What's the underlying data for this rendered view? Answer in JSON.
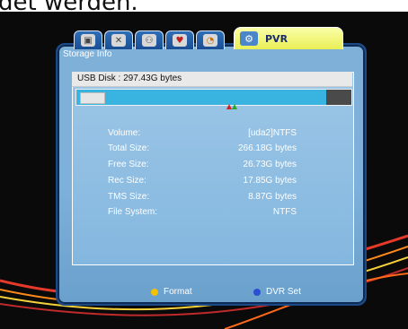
{
  "caption": "det werden.",
  "tabs": {
    "icons": [
      "film-reel-icon",
      "tools-icon",
      "network-icon",
      "heart-icon",
      "clock-icon"
    ],
    "active": {
      "icon": "gear-icon",
      "label": "PVR"
    }
  },
  "panel": {
    "title": "Storage Info",
    "disk_label": "USB Disk : 297.43G bytes",
    "usage_fraction": 0.91,
    "rows": [
      {
        "key": "Volume:",
        "value": "[uda2]NTFS"
      },
      {
        "key": "Total Size:",
        "value": "266.18G bytes"
      },
      {
        "key": "Free Size:",
        "value": "26.73G bytes"
      },
      {
        "key": "Rec Size:",
        "value": "17.85G bytes"
      },
      {
        "key": "TMS Size:",
        "value": "8.87G bytes"
      },
      {
        "key": "File System:",
        "value": "NTFS"
      }
    ]
  },
  "footer": {
    "format": {
      "label": "Format",
      "color": "#f2c200"
    },
    "dvr_set": {
      "label": "DVR Set",
      "color": "#2a4fd0"
    }
  },
  "colors": {
    "panel_bg": "#7fb0d8",
    "bar_used": "#39b3df",
    "bar_free": "#4a4a4a",
    "active_tab": "#e9ee55"
  }
}
